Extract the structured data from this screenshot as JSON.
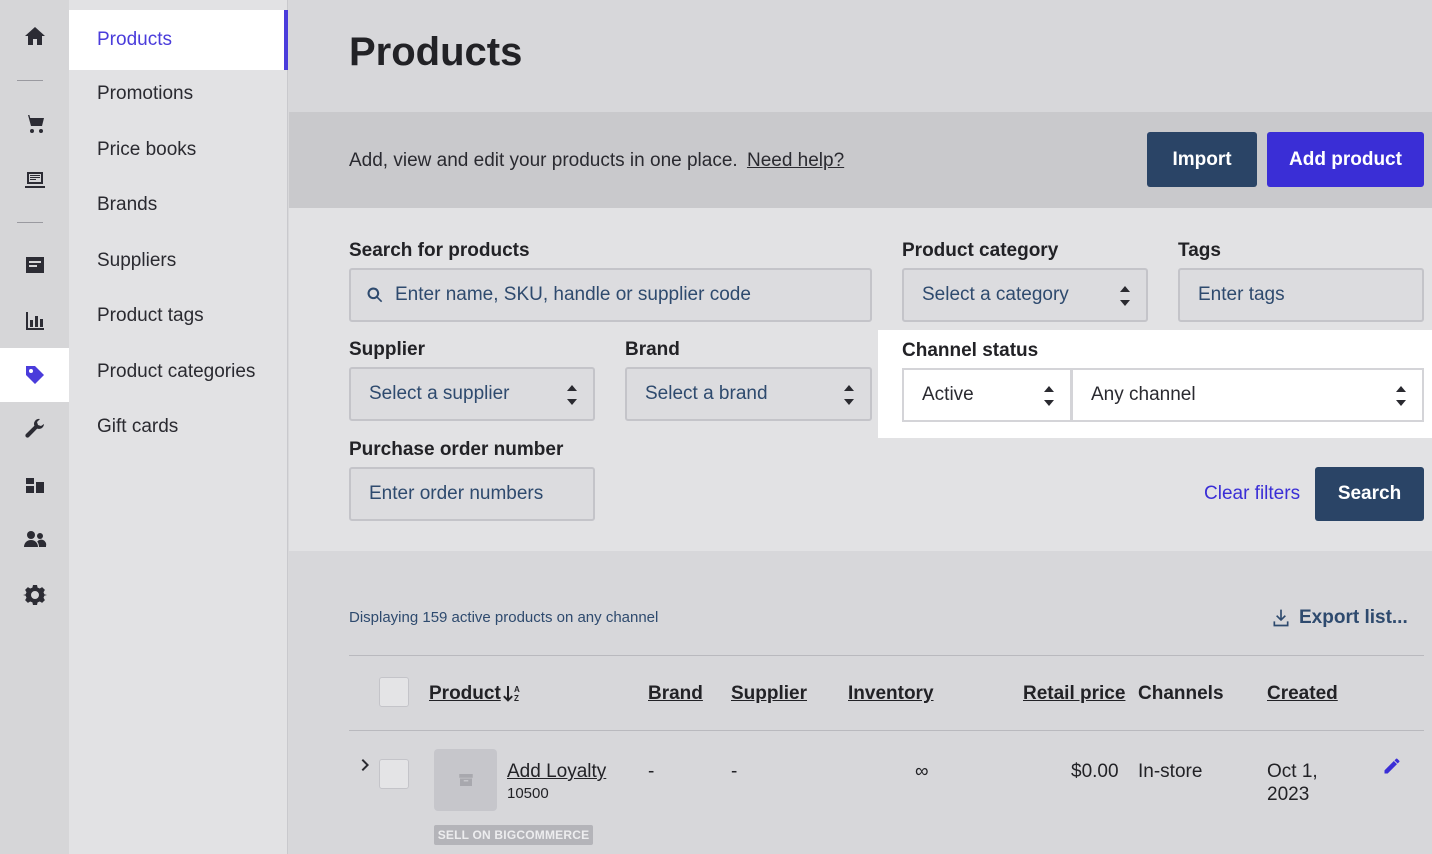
{
  "rail": {
    "icons": [
      "home-icon",
      "cart-icon",
      "register-icon",
      "sales-ledger-icon",
      "reports-icon",
      "tag-icon",
      "wrench-icon",
      "inventory-icon",
      "customers-icon",
      "gear-icon"
    ],
    "active": "tag-icon"
  },
  "subnav": {
    "items": [
      {
        "label": "Products"
      },
      {
        "label": "Promotions"
      },
      {
        "label": "Price books"
      },
      {
        "label": "Brands"
      },
      {
        "label": "Suppliers"
      },
      {
        "label": "Product tags"
      },
      {
        "label": "Product categories"
      },
      {
        "label": "Gift cards"
      }
    ],
    "active": "Products"
  },
  "page": {
    "title": "Products",
    "intro_text": "Add, view and edit your products in one place.",
    "help_link": "Need help?",
    "import_label": "Import",
    "add_product_label": "Add product"
  },
  "filters": {
    "search_label": "Search for products",
    "search_placeholder": "Enter name, SKU, handle or supplier code",
    "category_label": "Product category",
    "category_placeholder": "Select a category",
    "tags_label": "Tags",
    "tags_placeholder": "Enter tags",
    "supplier_label": "Supplier",
    "supplier_placeholder": "Select a supplier",
    "brand_label": "Brand",
    "brand_placeholder": "Select a brand",
    "channel_status_label": "Channel status",
    "status_value": "Active",
    "channel_value": "Any channel",
    "po_label": "Purchase order number",
    "po_placeholder": "Enter order numbers",
    "clear_label": "Clear filters",
    "search_button": "Search"
  },
  "list": {
    "display_text": "Displaying 159 active products on any channel",
    "export_label": "Export list...",
    "columns": {
      "product": "Product",
      "brand": "Brand",
      "supplier": "Supplier",
      "inventory": "Inventory",
      "retail_price": "Retail price",
      "channels": "Channels",
      "created": "Created"
    },
    "rows": [
      {
        "name": "Add Loyalty",
        "sku": "10500",
        "brand": "-",
        "supplier": "-",
        "inventory": "∞",
        "retail_price": "$0.00",
        "channels": "In-store",
        "created_line1": "Oct 1,",
        "created_line2": "2023",
        "badge": "SELL ON BIGCOMMERCE"
      }
    ]
  },
  "colors": {
    "accent": "#3a2ed6",
    "navy": "#2a4466"
  }
}
